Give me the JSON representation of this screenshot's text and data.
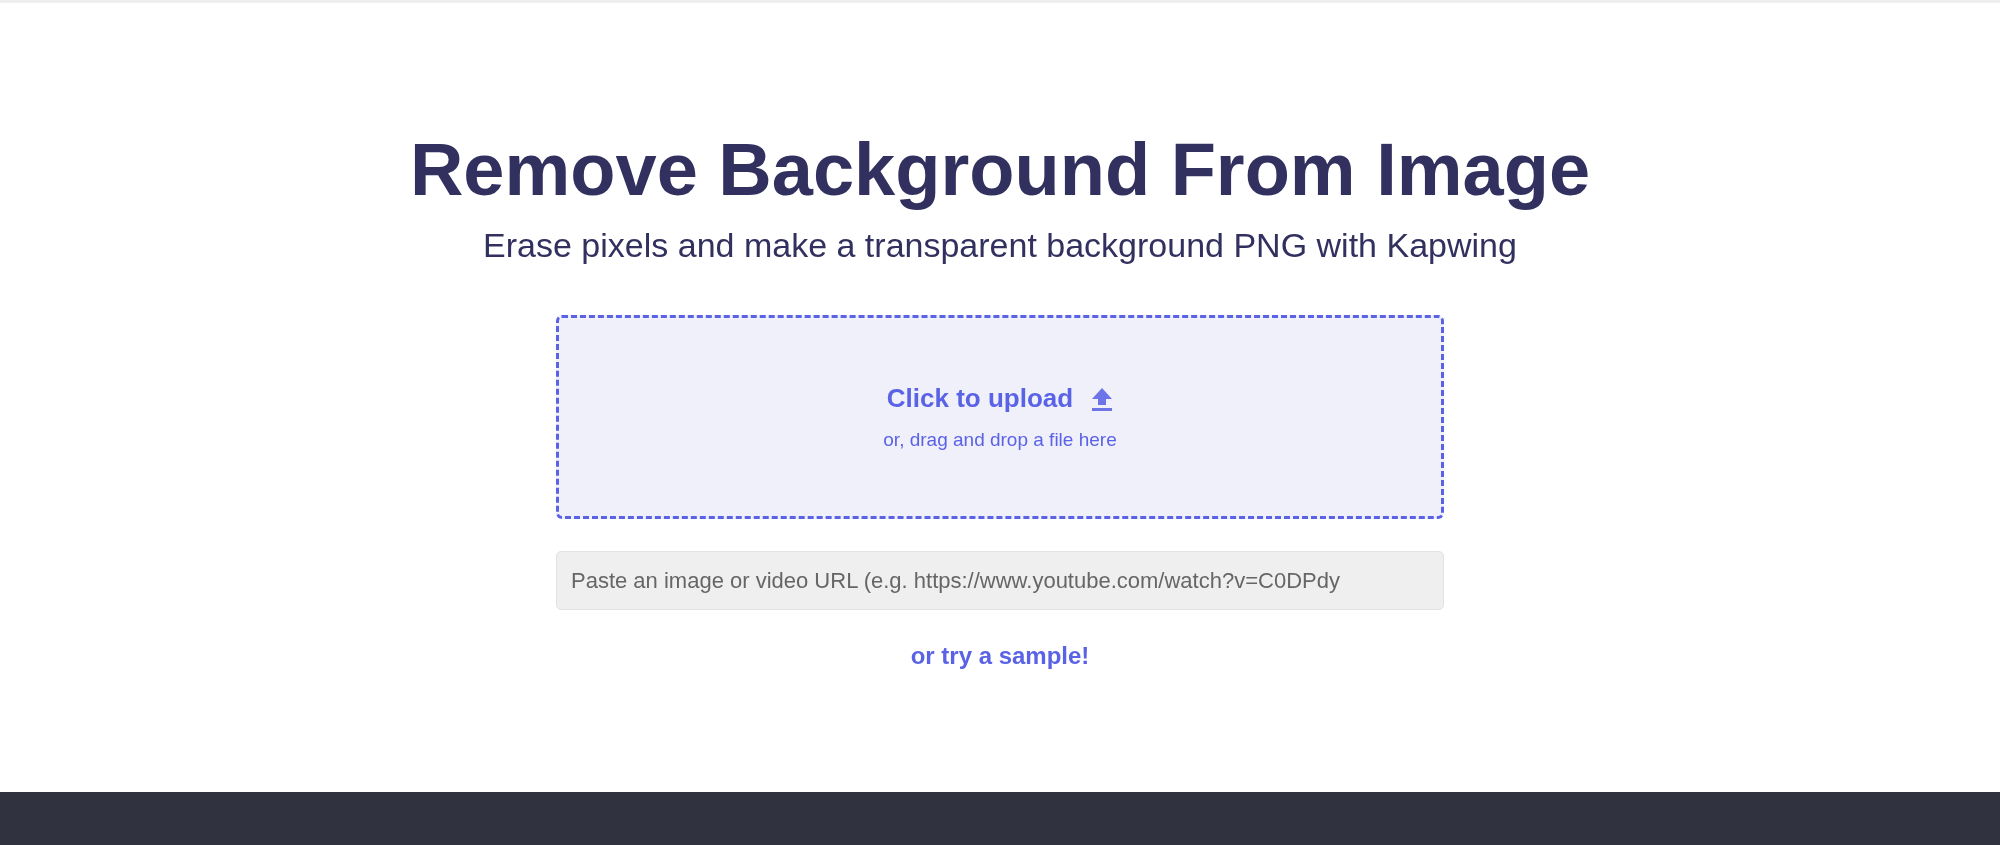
{
  "title": "Remove Background From Image",
  "subtitle": "Erase pixels and make a transparent background PNG with Kapwing",
  "upload": {
    "label": "Click to upload",
    "hint": "or, drag and drop a file here"
  },
  "url_field": {
    "placeholder": "Paste an image or video URL (e.g. https://www.youtube.com/watch?v=C0DPdy"
  },
  "sample_link": "or try a sample!"
}
